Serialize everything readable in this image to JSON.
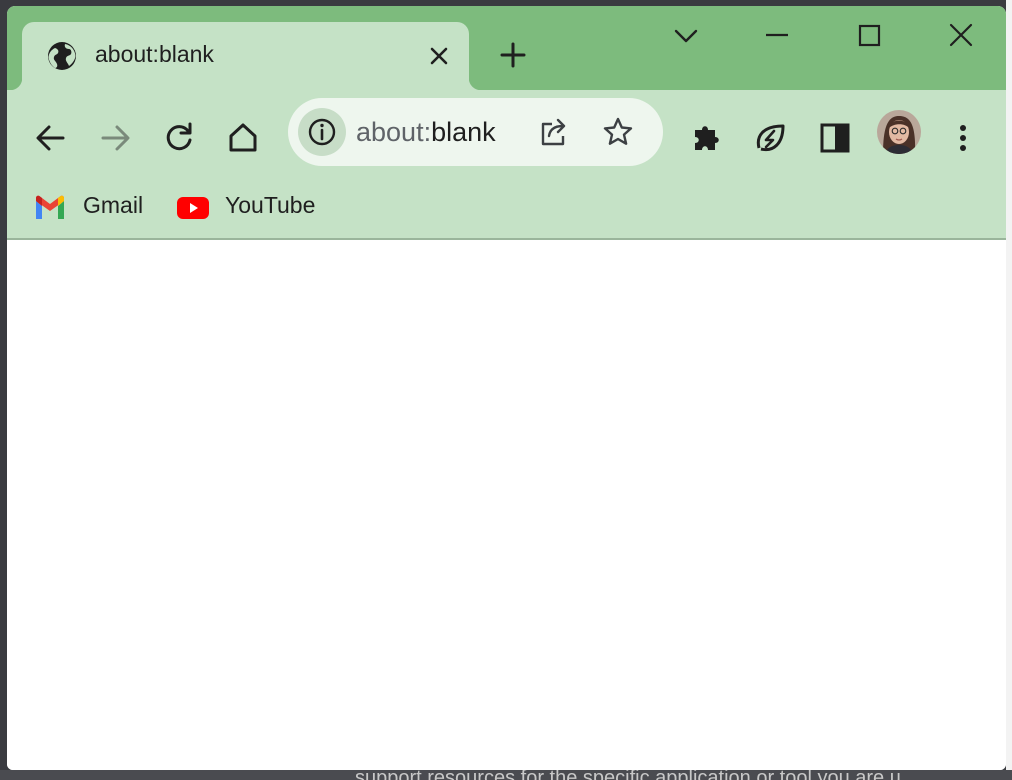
{
  "tab": {
    "title": "about:blank"
  },
  "omnibox": {
    "scheme": "about:",
    "rest": "blank"
  },
  "bookmarks": [
    {
      "label": "Gmail"
    },
    {
      "label": "YouTube"
    }
  ],
  "background_text": "support resources for the specific application or tool you are u",
  "colors": {
    "titlebar": "#7dbb7d",
    "tab_active": "#c5e2c6",
    "toolbar": "#c5e2c6",
    "omnibox": "#eef6ee",
    "page": "#ffffff"
  },
  "icons": {
    "tab": "globe-icon",
    "tab_close": "close-icon",
    "new_tab": "plus-icon",
    "tab_search": "chevron-down-icon",
    "minimize": "minimize-icon",
    "maximize": "maximize-icon",
    "close_window": "close-icon",
    "back": "arrow-left-icon",
    "forward": "arrow-right-icon",
    "reload": "reload-icon",
    "home": "home-icon",
    "site_info": "info-icon",
    "share": "share-icon",
    "bookmark_star": "star-icon",
    "extensions": "puzzle-icon",
    "memory_saver": "leaf-icon",
    "side_panel": "side-panel-icon",
    "menu": "kebab-menu-icon"
  }
}
